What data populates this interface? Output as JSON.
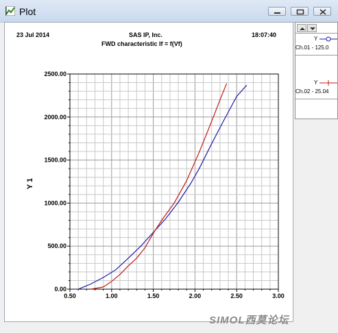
{
  "window": {
    "title": "Plot",
    "icons": {
      "app": "plot-app-icon",
      "minimize": "minimize-icon",
      "maximize": "maximize-icon",
      "close": "close-icon"
    }
  },
  "header": {
    "date": "23 Jul 2014",
    "company": "SAS IP, Inc.",
    "subtitle": "FWD characteristic If = f(Vf)",
    "time": "18:07:40"
  },
  "legend": {
    "scroll_up_icon": "scroll-up-icon",
    "scroll_down_icon": "scroll-down-icon",
    "entries": [
      {
        "prefix": "Y",
        "label": "Ch.01 - 125.0",
        "color": "#1a1aa8",
        "marker": "circle"
      },
      {
        "prefix": "Y",
        "label": "Ch.02 - 25.04",
        "color": "#c01818",
        "marker": "plus"
      }
    ]
  },
  "watermark": "SIMOL西莫论坛",
  "chart_data": {
    "type": "line",
    "title": "",
    "xlabel": "",
    "ylabel": "Y 1",
    "xlim": [
      0.5,
      3.0
    ],
    "ylim": [
      0,
      2500
    ],
    "x_ticks": [
      "0.50",
      "1.00",
      "1.50",
      "2.00",
      "2.50",
      "3.00"
    ],
    "y_ticks": [
      "0.00",
      "500.00",
      "1000.00",
      "1500.00",
      "2000.00",
      "2500.00"
    ],
    "grid": true,
    "legend_position": "right",
    "series": [
      {
        "name": "Ch.01 - 125.0",
        "color": "#1a1aa8",
        "x": [
          0.6,
          0.75,
          0.9,
          1.05,
          1.2,
          1.35,
          1.5,
          1.65,
          1.8,
          1.95,
          2.05,
          2.2,
          2.35,
          2.5,
          2.62
        ],
        "y": [
          0,
          60,
          135,
          225,
          360,
          500,
          660,
          820,
          1010,
          1230,
          1400,
          1690,
          1970,
          2240,
          2370
        ]
      },
      {
        "name": "Ch.02 - 25.04",
        "color": "#c01818",
        "x": [
          0.75,
          0.9,
          1.0,
          1.1,
          1.2,
          1.3,
          1.4,
          1.5,
          1.6,
          1.75,
          1.9,
          2.05,
          2.2,
          2.3,
          2.38
        ],
        "y": [
          0,
          25,
          90,
          170,
          270,
          360,
          480,
          650,
          800,
          1000,
          1260,
          1590,
          1950,
          2200,
          2390
        ]
      }
    ]
  }
}
